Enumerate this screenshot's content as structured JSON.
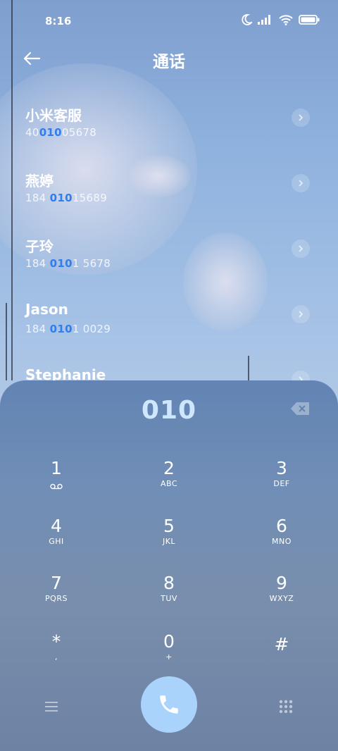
{
  "status": {
    "time": "8:16"
  },
  "header": {
    "title": "通话"
  },
  "contacts": [
    {
      "name": "小米客服",
      "num_before": "40",
      "num_match": "010",
      "num_after": "05678"
    },
    {
      "name": "燕婷",
      "num_before": "184 ",
      "num_match": "010",
      "num_after": "15689"
    },
    {
      "name": "子玲",
      "num_before": "184 ",
      "num_match": "010",
      "num_after": "1 5678"
    },
    {
      "name": "Jason",
      "num_before": "184 ",
      "num_match": "010",
      "num_after": "1 0029"
    },
    {
      "name": "Stephanie",
      "num_before": "",
      "num_match": "",
      "num_after": ""
    }
  ],
  "dialer": {
    "input": "010",
    "keys": [
      {
        "digit": "1",
        "sub": ""
      },
      {
        "digit": "2",
        "sub": "ABC"
      },
      {
        "digit": "3",
        "sub": "DEF"
      },
      {
        "digit": "4",
        "sub": "GHI"
      },
      {
        "digit": "5",
        "sub": "JKL"
      },
      {
        "digit": "6",
        "sub": "MNO"
      },
      {
        "digit": "7",
        "sub": "PQRS"
      },
      {
        "digit": "8",
        "sub": "TUV"
      },
      {
        "digit": "9",
        "sub": "WXYZ"
      },
      {
        "digit": "*",
        "sub": ","
      },
      {
        "digit": "0",
        "sub": "+"
      },
      {
        "digit": "#",
        "sub": ""
      }
    ]
  },
  "colors": {
    "accent": "#2f7ef0",
    "call_button": "#a9d3fb",
    "input_text": "#cfe6ff"
  },
  "icons": [
    "moon-icon",
    "signal-icon",
    "wifi-icon",
    "battery-icon",
    "back-arrow-icon",
    "chevron-right-icon",
    "backspace-icon",
    "voicemail-icon",
    "menu-icon",
    "phone-icon",
    "dialpad-grid-icon"
  ]
}
